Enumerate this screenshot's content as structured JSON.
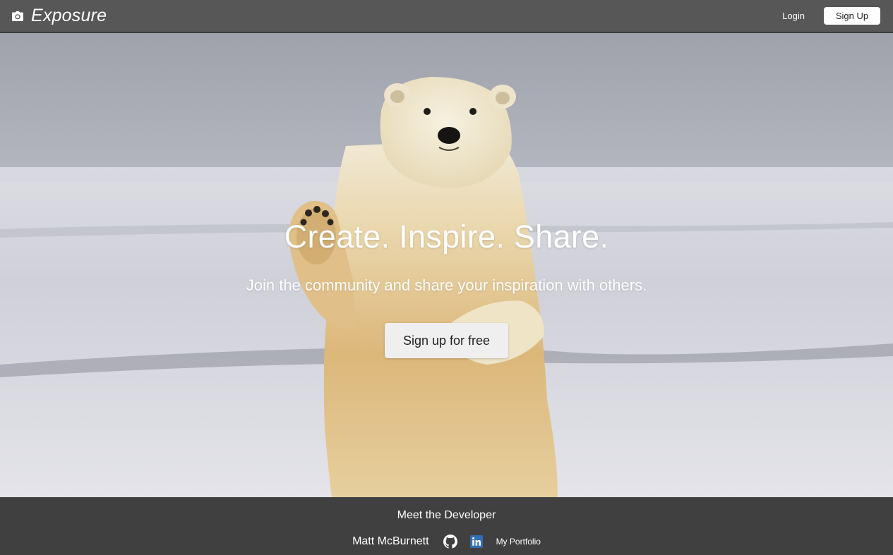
{
  "header": {
    "brand_name": "Exposure",
    "brand_icon": "camera-icon",
    "login_label": "Login",
    "signup_label": "Sign Up"
  },
  "hero": {
    "background_image": "polar-bear-waving-in-snow",
    "title": "Create. Inspire. Share.",
    "subtitle": "Join the community and share your inspiration with others.",
    "cta_label": "Sign up for free"
  },
  "footer": {
    "heading": "Meet the Developer",
    "developer_name": "Matt McBurnett",
    "github_icon": "github-icon",
    "linkedin_icon": "linkedin-icon",
    "portfolio_label": "My Portfolio"
  },
  "colors": {
    "navbar_bg": "#575757",
    "footer_bg": "#404040",
    "cta_bg": "#efefef",
    "linkedin_blue": "#2e6fb6"
  }
}
